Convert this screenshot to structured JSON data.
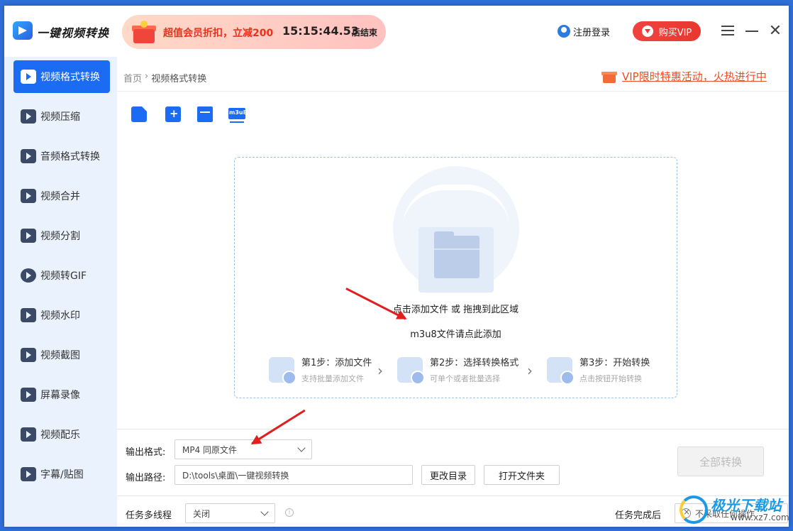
{
  "app": {
    "title": "一键视频转换"
  },
  "promo": {
    "text": "超值会员折扣，立减200",
    "countdown": "15:15:44.53",
    "end_suffix": "后结束"
  },
  "header": {
    "login_label": "注册登录",
    "vip_label": "购买VIP",
    "close_glyph": "✕"
  },
  "sidebar": {
    "items": [
      {
        "label": "视频格式转换",
        "icon": "video-convert-icon",
        "active": true
      },
      {
        "label": "视频压缩",
        "icon": "compress-icon"
      },
      {
        "label": "音频格式转换",
        "icon": "audio-convert-icon"
      },
      {
        "label": "视频合并",
        "icon": "merge-icon"
      },
      {
        "label": "视频分割",
        "icon": "split-icon"
      },
      {
        "label": "视频转GIF",
        "icon": "gif-icon"
      },
      {
        "label": "视频水印",
        "icon": "watermark-icon"
      },
      {
        "label": "视频截图",
        "icon": "screenshot-icon"
      },
      {
        "label": "屏幕录像",
        "icon": "record-icon"
      },
      {
        "label": "视频配乐",
        "icon": "music-icon"
      },
      {
        "label": "字幕/贴图",
        "icon": "subtitle-icon"
      }
    ]
  },
  "breadcrumb": {
    "home": "首页",
    "sep": "›",
    "current": "视频格式转换"
  },
  "vip_activity": {
    "text": "VIP限时特惠活动，火热进行中"
  },
  "toolbar": {
    "m3u8_label": "m3u8"
  },
  "dropzone": {
    "hint": "点击添加文件 或 拖拽到此区域",
    "m3u8_hint": "m3u8文件请点此添加",
    "steps": [
      {
        "title": "第1步：添加文件",
        "sub": "支持批量添加文件"
      },
      {
        "title": "第2步：选择转换格式",
        "sub": "可单个或者批量选择"
      },
      {
        "title": "第3步：开始转换",
        "sub": "点击按钮开始转换"
      }
    ],
    "arrow_glyph": "›"
  },
  "output": {
    "format_label": "输出格式:",
    "format_value": "MP4  同原文件",
    "path_label": "输出路径:",
    "path_value": "D:\\tools\\桌面\\一键视频转换",
    "change_dir": "更改目录",
    "open_folder": "打开文件夹",
    "convert_all": "全部转换"
  },
  "footer": {
    "multithread_label": "任务多线程",
    "multithread_value": "关闭",
    "info_glyph": "i",
    "after_label": "任务完成后",
    "after_value": "不采取任何操作"
  },
  "watermark": {
    "name": "极光下载站",
    "url": "www.xz7.com"
  },
  "colors": {
    "accent": "#1b6cf2",
    "vip_red": "#e9372f",
    "promo_orange": "#f04d1f"
  }
}
